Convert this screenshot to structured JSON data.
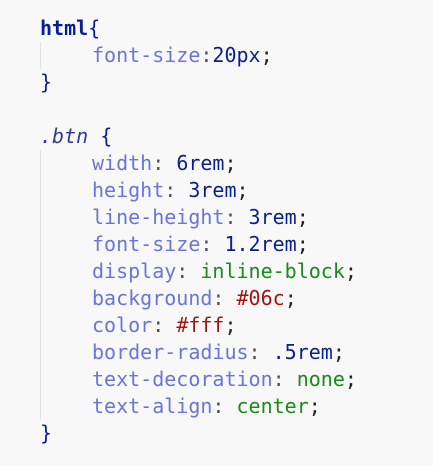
{
  "block1": {
    "selector": "html",
    "open": "{",
    "declarations": [
      {
        "prop": "font-size",
        "colon": ":",
        "value": "20px",
        "type": "num",
        "semi": ";"
      }
    ],
    "close": "}"
  },
  "block2": {
    "selector": ".btn",
    "open": " {",
    "declarations": [
      {
        "prop": "width",
        "colon": ": ",
        "value": "6rem",
        "type": "num",
        "semi": ";"
      },
      {
        "prop": "height",
        "colon": ": ",
        "value": "3rem",
        "type": "num",
        "semi": ";"
      },
      {
        "prop": "line-height",
        "colon": ": ",
        "value": "3rem",
        "type": "num",
        "semi": ";"
      },
      {
        "prop": "font-size",
        "colon": ": ",
        "value": "1.2rem",
        "type": "num",
        "semi": ";"
      },
      {
        "prop": "display",
        "colon": ": ",
        "value": "inline-block",
        "type": "kw",
        "semi": ";"
      },
      {
        "prop": "background",
        "colon": ": ",
        "value": "#06c",
        "type": "hex",
        "semi": ";"
      },
      {
        "prop": "color",
        "colon": ": ",
        "value": "#fff",
        "type": "hex",
        "semi": ";"
      },
      {
        "prop": "border-radius",
        "colon": ": ",
        "value": ".5rem",
        "type": "num",
        "semi": ";"
      },
      {
        "prop": "text-decoration",
        "colon": ": ",
        "value": "none",
        "type": "kw",
        "semi": ";"
      },
      {
        "prop": "text-align",
        "colon": ": ",
        "value": "center",
        "type": "kw",
        "semi": ";"
      }
    ],
    "close": "}"
  },
  "colors": {
    "selector": "#0a1f8f",
    "property": "#6a76d6",
    "number": "#0a1f8f",
    "keyword": "#1a8a1a",
    "hex": "#a31515",
    "background": "#f8f8f8"
  }
}
